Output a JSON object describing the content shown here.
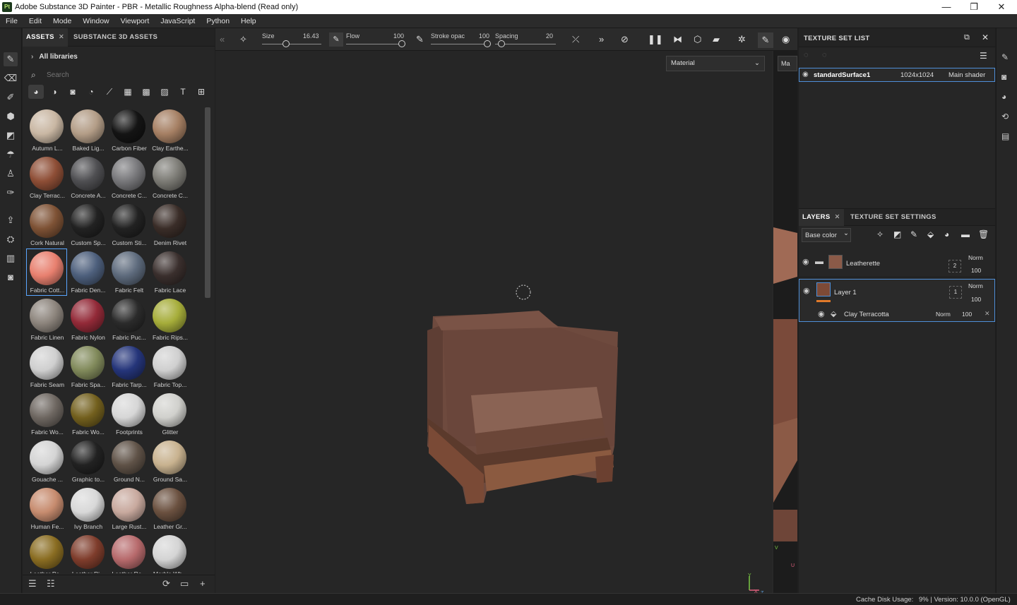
{
  "app": {
    "logo": "Pt",
    "title": "Adobe Substance 3D Painter - PBR - Metallic Roughness Alpha-blend (Read only)"
  },
  "window_controls": {
    "minimize": "—",
    "maximize": "❐",
    "close": "✕"
  },
  "menu": [
    "File",
    "Edit",
    "Mode",
    "Window",
    "Viewport",
    "JavaScript",
    "Python",
    "Help"
  ],
  "assets_panel": {
    "tabs": [
      "ASSETS",
      "SUBSTANCE 3D ASSETS"
    ],
    "close": "✕",
    "library": "All libraries",
    "search_placeholder": "Search",
    "materials": [
      {
        "name": "Autumn L...",
        "color": "#c9b7a3"
      },
      {
        "name": "Baked Lig...",
        "color": "#b39d87"
      },
      {
        "name": "Carbon Fiber",
        "color": "#141414"
      },
      {
        "name": "Clay Earthe...",
        "color": "#a57f63"
      },
      {
        "name": "Clay Terrac...",
        "color": "#8e4e36"
      },
      {
        "name": "Concrete A...",
        "color": "#4f4f52"
      },
      {
        "name": "Concrete C...",
        "color": "#77777a"
      },
      {
        "name": "Concrete C...",
        "color": "#7c7b75"
      },
      {
        "name": "Cork Natural",
        "color": "#7e5235"
      },
      {
        "name": "Custom Sp...",
        "color": "#222222"
      },
      {
        "name": "Custom Sti...",
        "color": "#222222"
      },
      {
        "name": "Denim Rivet",
        "color": "#3a2d28"
      },
      {
        "name": "Fabric Cott...",
        "color": "#e8806f"
      },
      {
        "name": "Fabric Den...",
        "color": "#4d5f7c"
      },
      {
        "name": "Fabric Felt",
        "color": "#5d6a7c"
      },
      {
        "name": "Fabric Lace",
        "color": "#3a2f2d"
      },
      {
        "name": "Fabric Linen",
        "color": "#8d857d"
      },
      {
        "name": "Fabric Nylon",
        "color": "#932a38"
      },
      {
        "name": "Fabric Puc...",
        "color": "#2b2b2b"
      },
      {
        "name": "Fabric Rips...",
        "color": "#a6ad3a"
      },
      {
        "name": "Fabric Seam",
        "color": "#cfcfcf"
      },
      {
        "name": "Fabric Spa...",
        "color": "#818a5b"
      },
      {
        "name": "Fabric Tarp...",
        "color": "#25357a"
      },
      {
        "name": "Fabric Top...",
        "color": "#cfcfcf"
      },
      {
        "name": "Fabric Wo...",
        "color": "#6e6761"
      },
      {
        "name": "Fabric Wo...",
        "color": "#73601e"
      },
      {
        "name": "Footprints",
        "color": "#d6d6d6"
      },
      {
        "name": "Glitter",
        "color": "#d0d0cc"
      },
      {
        "name": "Gouache ...",
        "color": "#d4d4d4"
      },
      {
        "name": "Graphic to...",
        "color": "#222222"
      },
      {
        "name": "Ground N...",
        "color": "#5f5247"
      },
      {
        "name": "Ground Sa...",
        "color": "#c8b28f"
      },
      {
        "name": "Human Fe...",
        "color": "#c78c6f"
      },
      {
        "name": "Ivy Branch",
        "color": "#d8d8d8"
      },
      {
        "name": "Large Rust...",
        "color": "#c8a99e"
      },
      {
        "name": "Leather Gr...",
        "color": "#6b5140"
      },
      {
        "name": "Leather Pa...",
        "color": "#8a6d22"
      },
      {
        "name": "Leather Ri...",
        "color": "#7f3d2c"
      },
      {
        "name": "Leather Ro...",
        "color": "#b76a6c"
      },
      {
        "name": "Marble Wh...",
        "color": "#d4d4d4"
      }
    ]
  },
  "toolbar": {
    "size_label": "Size",
    "size_value": "16.43",
    "flow_label": "Flow",
    "flow_value": "100",
    "stroke_label": "Stroke opac",
    "stroke_value": "100",
    "spacing_label": "Spacing",
    "spacing_value": "20",
    "material_select": "Material",
    "ma_select": "Ma"
  },
  "texture_set_list": {
    "title": "TEXTURE SET LIST",
    "set_name": "standardSurface1",
    "resolution": "1024x1024",
    "shader": "Main shader"
  },
  "layers": {
    "tabs": [
      "LAYERS",
      "TEXTURE SET SETTINGS"
    ],
    "channel": "Base color",
    "items": [
      {
        "name": "Leatherette",
        "blend": "Norm",
        "opacity": "100",
        "count": "2"
      },
      {
        "name": "Layer 1",
        "blend": "Norm",
        "opacity": "100",
        "count": "1"
      }
    ],
    "effect": {
      "name": "Clay Terracotta",
      "blend": "Norm",
      "opacity": "100"
    }
  },
  "status": {
    "cache_label": "Cache Disk Usage:",
    "cache_value": "9% | Version: 10.0.0 (OpenGL)"
  },
  "gizmo": {
    "y": "Y",
    "x": "X",
    "z": "Z",
    "u": "U",
    "v": "V"
  }
}
